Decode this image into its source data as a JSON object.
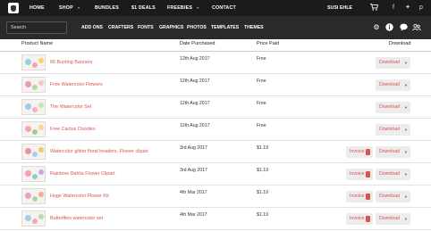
{
  "topnav": {
    "items": [
      {
        "label": "HOME",
        "chevron": false
      },
      {
        "label": "SHOP",
        "chevron": true
      },
      {
        "label": "BUNDLES",
        "chevron": false
      },
      {
        "label": "$1 DEALS",
        "chevron": false
      },
      {
        "label": "FREEBIES",
        "chevron": true
      },
      {
        "label": "CONTACT",
        "chevron": false
      }
    ],
    "user": "SUSI EHLE",
    "icons": [
      "cart-icon",
      "facebook-icon",
      "twitter-icon",
      "pinterest-icon"
    ]
  },
  "subnav": {
    "search_placeholder": "Search",
    "items": [
      "ADD ONS",
      "CRAFTERS",
      "FONTS",
      "GRAPHICS",
      "PHOTOS",
      "TEMPLATES",
      "THEMES"
    ],
    "icons": [
      "gear-icon",
      "info-icon",
      "chat-icon",
      "users-icon"
    ]
  },
  "table": {
    "headers": {
      "product": "Product Name",
      "date": "Date Purchased",
      "price": "Price Paid",
      "download": "Download"
    },
    "invoice_label": "Invoice",
    "download_label": "Download",
    "rows": [
      {
        "name": "66 Bunting Banners",
        "date": "12th Aug 2017",
        "price": "Free",
        "invoice": false
      },
      {
        "name": "Free Watercolor Flowers",
        "date": "12th Aug 2017",
        "price": "Free",
        "invoice": false
      },
      {
        "name": "The Watercolor Set",
        "date": "12th Aug 2017",
        "price": "Free",
        "invoice": false
      },
      {
        "name": "Free Cactus Doodles",
        "date": "12th Aug 2017",
        "price": "Free",
        "invoice": false
      },
      {
        "name": "Watercolor glitter floral headers. Flower clipart",
        "date": "3rd Aug 2017",
        "price": "$1.19",
        "invoice": true
      },
      {
        "name": "Rainbow Dahlia Flower Clipart",
        "date": "3rd Aug 2017",
        "price": "$1.19",
        "invoice": true
      },
      {
        "name": "Huge Watercolor Flower Kit",
        "date": "4th Mar 2017",
        "price": "$1.19",
        "invoice": true
      },
      {
        "name": "Butterflies watercolor set",
        "date": "4th Mar 2017",
        "price": "$1.19",
        "invoice": true
      }
    ]
  },
  "colors": {
    "nav_bg": "#1b1b1b",
    "subnav_bg": "#2a2a2a",
    "accent": "#d9534f",
    "button_bg": "#ececec"
  }
}
